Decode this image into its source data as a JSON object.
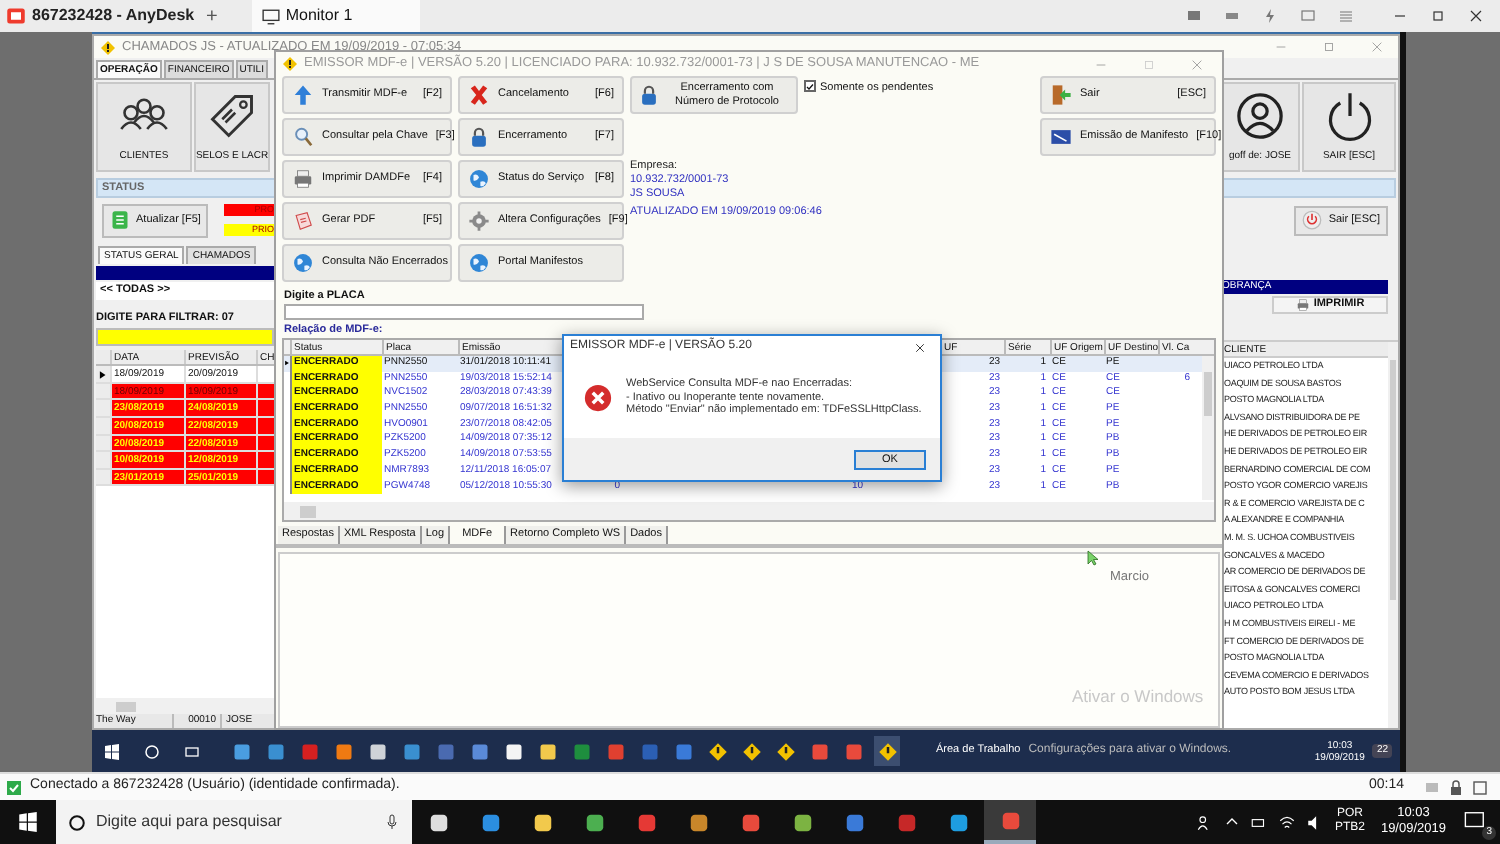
{
  "anydesk": {
    "address": "867232428 - AnyDesk",
    "new_tab": "+",
    "tab": "Monitor 1",
    "status": "Conectado a 867232428 (Usuário) (identidade confirmada).",
    "timer": "00:14"
  },
  "back_window": {
    "title": "CHAMADOS JS - ATUALIZADO EM 19/09/2019 - 07:05:34",
    "tabs": [
      {
        "label": "OPERAÇÃO",
        "selected": true
      },
      {
        "label": "FINANCEIRO",
        "selected": false
      },
      {
        "label": "UTILI",
        "selected": false
      }
    ],
    "tiles": [
      "CLIENTES",
      "SELOS E LACR"
    ],
    "right_tiles": [
      "goff de: JOSE",
      "SAIR [ESC]"
    ],
    "status_header": "STATUS",
    "refresh_button": "Atualizar [F5]",
    "legend": [
      {
        "label": "PRO",
        "color": "#ff0000"
      },
      {
        "label": "PRIO",
        "color": "#ffff00"
      }
    ],
    "subtabs": [
      {
        "label": "STATUS GERAL",
        "selected": true
      },
      {
        "label": "CHAMADOS",
        "selected": false
      }
    ],
    "filter_option": "<< TODAS >>",
    "filter_label": "DIGITE PARA FILTRAR: 07",
    "table": {
      "columns": [
        "DATA",
        "PREVISÃO",
        "CH"
      ],
      "rows": [
        {
          "data": "18/09/2019",
          "previsao": "20/09/2019",
          "kind": "normal",
          "selected": true
        },
        {
          "data": "18/09/2019",
          "previsao": "19/09/2019",
          "kind": "due",
          "selected": false
        },
        {
          "data": "23/08/2019",
          "previsao": "24/08/2019",
          "kind": "late",
          "selected": false
        },
        {
          "data": "20/08/2019",
          "previsao": "22/08/2019",
          "kind": "late",
          "selected": false
        },
        {
          "data": "20/08/2019",
          "previsao": "22/08/2019",
          "kind": "late",
          "selected": false
        },
        {
          "data": "10/08/2019",
          "previsao": "12/08/2019",
          "kind": "late",
          "selected": false
        },
        {
          "data": "23/01/2019",
          "previsao": "25/01/2019",
          "kind": "late",
          "selected": false
        }
      ]
    },
    "footer": [
      "The Way",
      "00010",
      "JOSE"
    ],
    "exit_button": "Sair [ESC]",
    "band": "OBRANÇA",
    "print_button": "IMPRIMIR",
    "clients": {
      "column": "CLIENTE",
      "rows": [
        "UIACO PETROLEO LTDA",
        "OAQUIM DE SOUSA BASTOS",
        "POSTO MAGNOLIA LTDA",
        "ALVSANO DISTRIBUIDORA DE PE",
        "HE DERIVADOS DE PETROLEO EIR",
        "HE DERIVADOS DE PETROLEO EIR",
        "BERNARDINO COMERCIAL DE COM",
        "POSTO YGOR COMERCIO VAREJIS",
        "R & E COMERCIO VAREJISTA DE C",
        "A ALEXANDRE E COMPANHIA",
        "M. M. S. UCHOA COMBUSTIVEIS",
        "GONCALVES & MACEDO",
        "AR COMERCIO DE DERIVADOS DE",
        "EITOSA & GONCALVES COMERCI",
        "UIACO PETROLEO LTDA",
        "H M COMBUSTIVEIS EIRELI - ME",
        "FT COMERCIO DE DERIVADOS DE",
        "POSTO MAGNOLIA LTDA",
        "CEVEMA COMERCIO E DERIVADOS",
        "AUTO POSTO BOM JESUS LTDA"
      ]
    }
  },
  "front_window": {
    "title": "EMISSOR MDF-e | VERSÃO 5.20 | LICENCIADO PARA: 10.932.732/0001-73 | J S DE SOUSA MANUTENCAO - ME",
    "buttons_col1": [
      {
        "label": "Transmitir MDF-e",
        "key": "[F2]"
      },
      {
        "label": "Consultar pela Chave",
        "key": "[F3]"
      },
      {
        "label": "Imprimir DAMDFe",
        "key": "[F4]"
      },
      {
        "label": "Gerar PDF",
        "key": "[F5]"
      },
      {
        "label": "Consulta Não Encerrados"
      }
    ],
    "buttons_col2": [
      {
        "label": "Cancelamento",
        "key": "[F6]"
      },
      {
        "label": "Encerramento",
        "key": "[F7]"
      },
      {
        "label": "Status do Serviço",
        "key": "[F8]"
      },
      {
        "label": "Altera Configurações",
        "key": "[F9]"
      },
      {
        "label": "Portal Manifestos"
      }
    ],
    "protocol_button": "Encerramento com Número de Protocolo",
    "pending_only": {
      "label": "Somente os pendentes",
      "checked": true
    },
    "company": {
      "label": "Empresa:",
      "cnpj": "10.932.732/0001-73",
      "name": "JS SOUSA",
      "updated": "ATUALIZADO EM 19/09/2019 09:06:46"
    },
    "exit_button": {
      "label": "Sair",
      "key": "[ESC]"
    },
    "manifest_button": {
      "label": "Emissão de Manifesto",
      "key": "[F10]"
    },
    "plate_label": "Digite a PLACA",
    "list_label": "Relação de MDF-e:",
    "table": {
      "columns": [
        "Status",
        "Placa",
        "Emissão",
        "UF",
        "Série",
        "UF Origem",
        "UF Destino",
        "Vl. Ca"
      ],
      "rows": [
        {
          "status": "ENCERRADO",
          "placa": "PNN2550",
          "emissao": "31/01/2018 10:11:41",
          "uf": "23",
          "serie": "1",
          "origem": "CE",
          "destino": "PE",
          "selected": true
        },
        {
          "status": "ENCERRADO",
          "placa": "PNN2550",
          "emissao": "19/03/2018 15:52:14",
          "uf": "23",
          "serie": "1",
          "origem": "CE",
          "destino": "CE",
          "valor": "6",
          "selected": false
        },
        {
          "status": "ENCERRADO",
          "placa": "NVC1502",
          "emissao": "28/03/2018 07:43:39",
          "uf": "23",
          "serie": "1",
          "origem": "CE",
          "destino": "CE",
          "selected": false
        },
        {
          "status": "ENCERRADO",
          "placa": "PNN2550",
          "emissao": "09/07/2018 16:51:32",
          "uf": "23",
          "serie": "1",
          "origem": "CE",
          "destino": "PE",
          "selected": false
        },
        {
          "status": "ENCERRADO",
          "placa": "HVO0901",
          "emissao": "23/07/2018 08:42:05",
          "uf": "23",
          "serie": "1",
          "origem": "CE",
          "destino": "PE",
          "selected": false
        },
        {
          "status": "ENCERRADO",
          "placa": "PZK5200",
          "emissao": "14/09/2018 07:35:12",
          "uf": "23",
          "serie": "1",
          "origem": "CE",
          "destino": "PB",
          "selected": false
        },
        {
          "status": "ENCERRADO",
          "placa": "PZK5200",
          "emissao": "14/09/2018 07:53:55",
          "uf": "23",
          "serie": "1",
          "origem": "CE",
          "destino": "PB",
          "selected": false
        },
        {
          "status": "ENCERRADO",
          "placa": "NMR7893",
          "emissao": "12/11/2018 16:05:07",
          "uf": "23",
          "serie": "1",
          "origem": "CE",
          "destino": "PE",
          "selected": false
        },
        {
          "status": "ENCERRADO",
          "placa": "PGW4748",
          "emissao": "05/12/2018 10:55:30",
          "column_4": "0",
          "column_6": "10",
          "uf": "23",
          "serie": "1",
          "origem": "CE",
          "destino": "PB",
          "selected": false
        }
      ]
    },
    "bottom_tabs": [
      {
        "label": "Respostas",
        "selected": false
      },
      {
        "label": "XML Resposta",
        "selected": false
      },
      {
        "label": "Log",
        "selected": false
      },
      {
        "label": "MDFe",
        "selected": true
      },
      {
        "label": "Retorno Completo WS",
        "selected": false
      },
      {
        "label": "Dados",
        "selected": false
      }
    ]
  },
  "dialog": {
    "title": "EMISSOR MDF-e | VERSÃO 5.20",
    "lines": [
      "WebService Consulta MDF-e nao Encerradas:",
      "- Inativo ou Inoperante tente novamente.",
      "Método \"Enviar\" não implementado em: TDFeSSLHttpClass."
    ],
    "ok": "OK"
  },
  "cursor_label": "Marcio",
  "activation": [
    "Ativar o Windows",
    "Configurações para ativar o Windows."
  ],
  "remote_taskbar": {
    "desktop": "Área de Trabalho",
    "time": "10:03",
    "date": "19/09/2019",
    "badge": "22"
  },
  "taskbar": {
    "search_placeholder": "Digite aqui para pesquisar",
    "lang": "POR",
    "layout": "PTB2",
    "time": "10:03",
    "date": "19/09/2019",
    "badge": "3"
  }
}
